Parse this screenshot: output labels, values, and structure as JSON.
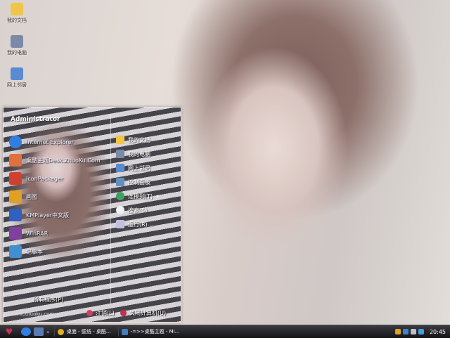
{
  "desktop": {
    "icons": [
      {
        "label": "我的文档",
        "icon": "folder-icon",
        "color": "#f0c64a"
      },
      {
        "label": "我的电脑",
        "icon": "computer-icon",
        "color": "#7a8aa8"
      },
      {
        "label": "网上邻居",
        "icon": "network-icon",
        "color": "#5a8ad0"
      }
    ]
  },
  "start_menu": {
    "user": "Administrator",
    "left_items": [
      {
        "label": "Internet Explorer",
        "icon": "ie-icon",
        "color": "#2f7fe0"
      },
      {
        "label": "桌酷主题Desk.ZhuoKu.Com",
        "icon": "theme-icon",
        "color": "#e07040"
      },
      {
        "label": "IconPackager",
        "icon": "iconpackager-icon",
        "color": "#d04030"
      },
      {
        "label": "画图",
        "icon": "paint-icon",
        "color": "#e0a020"
      },
      {
        "label": "KMPlayer中文版",
        "icon": "kmplayer-icon",
        "color": "#3060c0"
      },
      {
        "label": "WinRAR",
        "icon": "winrar-icon",
        "color": "#8040a0"
      },
      {
        "label": "记事本",
        "icon": "notepad-icon",
        "color": "#4090d0"
      }
    ],
    "right_items": [
      {
        "label": "我的文档",
        "icon": "folder-icon",
        "color": "#f0c64a",
        "arrow": false
      },
      {
        "label": "我的电脑",
        "icon": "computer-icon",
        "color": "#7a8aa8",
        "arrow": false
      },
      {
        "label": "网上邻居",
        "icon": "network-icon",
        "color": "#5a8ad0",
        "arrow": false
      },
      {
        "label": "控制面板",
        "icon": "control-panel-icon",
        "color": "#6090c0",
        "arrow": false
      },
      {
        "label": "连接到(T)",
        "icon": "connect-icon",
        "color": "#40a060",
        "arrow": true
      },
      {
        "label": "搜索(S)",
        "icon": "search-icon",
        "color": "#f0f0f0",
        "arrow": false
      },
      {
        "label": "运行(R)...",
        "icon": "run-icon",
        "color": "#c0c0e0",
        "arrow": false
      }
    ],
    "all_programs": "所有程序(P)",
    "footer": "www.zhuoku.com",
    "logoff": "注销(L)",
    "shutdown": "关闭计算机(U)"
  },
  "taskbar": {
    "tasks": [
      {
        "label": "桌面 - 壁纸 - 桌酷...",
        "icon": "chrome-icon",
        "color": "#e0b020"
      },
      {
        "label": "-=>>桌酷主题 - Mi...",
        "icon": "document-icon",
        "color": "#4080c0"
      }
    ],
    "clock": "20:45"
  }
}
